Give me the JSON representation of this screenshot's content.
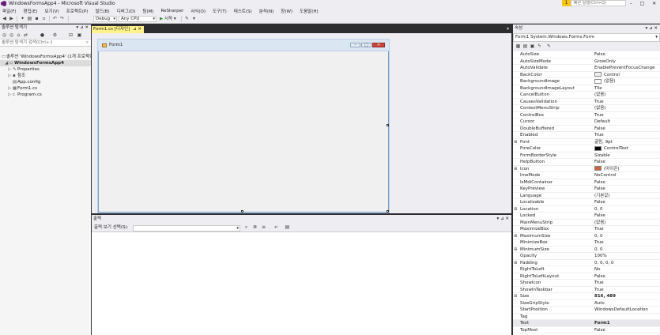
{
  "app": {
    "title": "WindowsFormsApp4 - Microsoft Visual Studio",
    "notification": "1",
    "quick_launch": "빠른 실행(Ctrl+Q)",
    "window_buttons": [
      "–",
      "□",
      "✕"
    ]
  },
  "menu": [
    "파일(F)",
    "편집(E)",
    "보기(V)",
    "프로젝트(P)",
    "빌드(B)",
    "디버그(D)",
    "팀(M)",
    "ReSharper",
    "서식(O)",
    "도구(T)",
    "테스트(S)",
    "분석(N)",
    "창(W)",
    "도움말(H)"
  ],
  "toolbar": {
    "config": "Debug",
    "platform": "Any CPU",
    "start_label": "시작"
  },
  "solution_explorer": {
    "title": "솔루션 탐색기",
    "search_placeholder": "솔루션 탐색기 검색(Ctrl+;)",
    "items": [
      {
        "label": "솔루션 'WindowsFormsApp4' (1개 프로젝트)",
        "icon": "solution-icon"
      },
      {
        "label": "WindowsFormsApp4",
        "icon": "csharp-project-icon"
      },
      {
        "label": "Properties",
        "icon": "wrench-icon"
      },
      {
        "label": "참조",
        "icon": "references-icon"
      },
      {
        "label": "App.config",
        "icon": "config-file-icon"
      },
      {
        "label": "Form1.cs",
        "icon": "form-icon"
      },
      {
        "label": "Program.cs",
        "icon": "csharp-file-icon"
      }
    ]
  },
  "document": {
    "tab_label": "Form1.cs [디자인]",
    "form_caption": "Form1"
  },
  "output": {
    "title": "출력",
    "source_label": "출력 보기 선택(S):"
  },
  "properties": {
    "title": "속성",
    "object": "Form1  System.Windows.Forms.Form",
    "rows": [
      {
        "name": "AutoSize",
        "value": "False"
      },
      {
        "name": "AutoSizeMode",
        "value": "GrowOnly"
      },
      {
        "name": "AutoValidate",
        "value": "EnablePreventFocusChange"
      },
      {
        "name": "BackColor",
        "value": "Control",
        "swatch": "#f0f0f0"
      },
      {
        "name": "BackgroundImage",
        "value": "(없음)",
        "swatch": "#ffffff"
      },
      {
        "name": "BackgroundImageLayout",
        "value": "Tile"
      },
      {
        "name": "CancelButton",
        "value": "(없음)"
      },
      {
        "name": "CausesValidation",
        "value": "True"
      },
      {
        "name": "ContextMenuStrip",
        "value": "(없음)"
      },
      {
        "name": "ControlBox",
        "value": "True"
      },
      {
        "name": "Cursor",
        "value": "Default"
      },
      {
        "name": "DoubleBuffered",
        "value": "False"
      },
      {
        "name": "Enabled",
        "value": "True"
      },
      {
        "name": "Font",
        "value": "굴림, 9pt",
        "expand": true
      },
      {
        "name": "ForeColor",
        "value": "ControlText",
        "swatch": "#000000"
      },
      {
        "name": "FormBorderStyle",
        "value": "Sizable"
      },
      {
        "name": "HelpButton",
        "value": "False"
      },
      {
        "name": "Icon",
        "value": "(아이콘)",
        "expand": true,
        "swatch": "#d06040"
      },
      {
        "name": "ImeMode",
        "value": "NoControl"
      },
      {
        "name": "IsMdiContainer",
        "value": "False"
      },
      {
        "name": "KeyPreview",
        "value": "False"
      },
      {
        "name": "Language",
        "value": "(기본값)"
      },
      {
        "name": "Localizable",
        "value": "False"
      },
      {
        "name": "Location",
        "value": "0, 0",
        "expand": true
      },
      {
        "name": "Locked",
        "value": "False"
      },
      {
        "name": "MainMenuStrip",
        "value": "(없음)"
      },
      {
        "name": "MaximizeBox",
        "value": "True"
      },
      {
        "name": "MaximumSize",
        "value": "0, 0",
        "expand": true
      },
      {
        "name": "MinimizeBox",
        "value": "True"
      },
      {
        "name": "MinimumSize",
        "value": "0, 0",
        "expand": true
      },
      {
        "name": "Opacity",
        "value": "100%"
      },
      {
        "name": "Padding",
        "value": "0, 0, 0, 0",
        "expand": true
      },
      {
        "name": "RightToLeft",
        "value": "No"
      },
      {
        "name": "RightToLeftLayout",
        "value": "False"
      },
      {
        "name": "ShowIcon",
        "value": "True"
      },
      {
        "name": "ShowInTaskbar",
        "value": "True"
      },
      {
        "name": "Size",
        "value": "816, 489",
        "expand": true,
        "bold": true
      },
      {
        "name": "SizeGripStyle",
        "value": "Auto"
      },
      {
        "name": "StartPosition",
        "value": "WindowsDefaultLocation"
      },
      {
        "name": "Tag",
        "value": ""
      },
      {
        "name": "Text",
        "value": "Form1",
        "bold": true
      },
      {
        "name": "TopMost",
        "value": "False"
      }
    ]
  }
}
